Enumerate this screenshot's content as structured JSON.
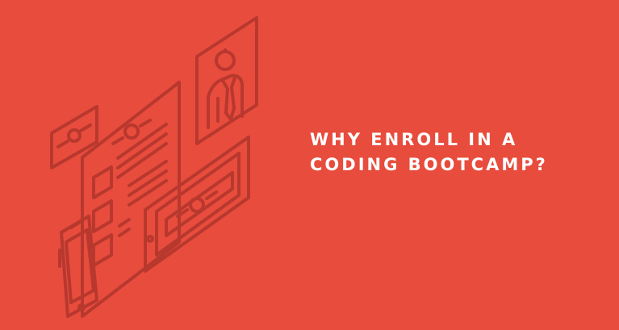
{
  "banner": {
    "background_color": "#e84c3d",
    "line_color": "#b8382e",
    "headline_line_1": "WHY ENROLL IN A",
    "headline_line_2": "CODING BOOTCAMP?",
    "icons": [
      "card-icon",
      "document-icon",
      "portrait-frame-icon",
      "person-tie-icon",
      "tablet-icon",
      "smartphone-icon"
    ]
  }
}
